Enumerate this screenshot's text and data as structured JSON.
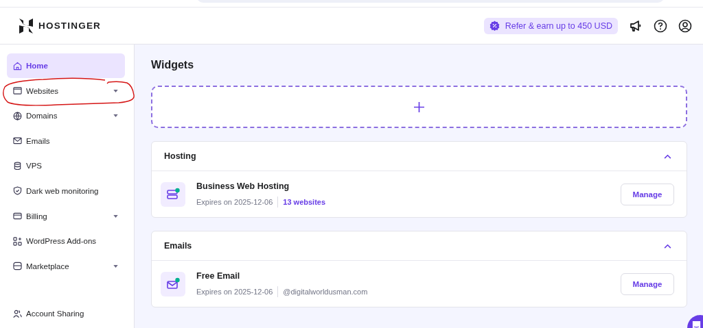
{
  "header": {
    "logo_text": "HOSTINGER",
    "referral": "Refer & earn up to 450 USD"
  },
  "sidebar": {
    "items": [
      {
        "label": "Home",
        "selected": true,
        "expandable": false
      },
      {
        "label": "Websites",
        "selected": false,
        "expandable": true
      },
      {
        "label": "Domains",
        "selected": false,
        "expandable": true
      },
      {
        "label": "Emails",
        "selected": false,
        "expandable": false
      },
      {
        "label": "VPS",
        "selected": false,
        "expandable": false
      },
      {
        "label": "Dark web monitoring",
        "selected": false,
        "expandable": false
      },
      {
        "label": "Billing",
        "selected": false,
        "expandable": true
      },
      {
        "label": "WordPress Add-ons",
        "selected": false,
        "expandable": false
      },
      {
        "label": "Marketplace",
        "selected": false,
        "expandable": true
      }
    ],
    "footer_items": [
      {
        "label": "Account Sharing",
        "selected": false
      }
    ]
  },
  "main": {
    "title": "Widgets",
    "sections": [
      {
        "title": "Hosting",
        "expanded": true,
        "items": [
          {
            "name": "Business Web Hosting",
            "expires": "Expires on 2025-12-06",
            "detail": "13 websites",
            "kind": "link",
            "button": "Manage"
          }
        ]
      },
      {
        "title": "Emails",
        "expanded": true,
        "items": [
          {
            "name": "Free Email",
            "expires": "Expires on 2025-12-06",
            "detail": "@digitalworldusman.com",
            "kind": "text",
            "button": "Manage"
          }
        ]
      }
    ]
  }
}
